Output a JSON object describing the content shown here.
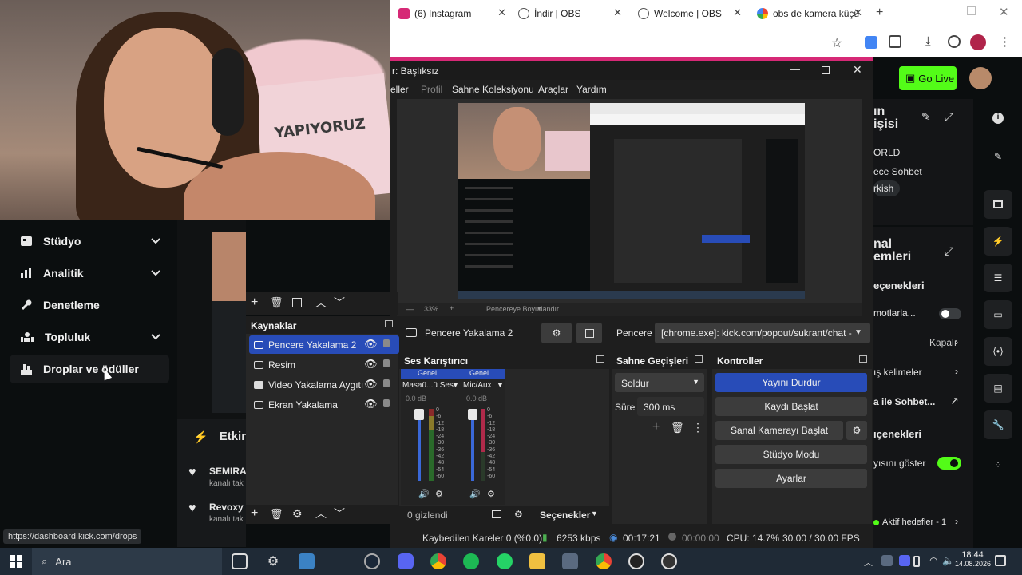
{
  "browser": {
    "tabs": [
      {
        "label": "(6) Instagram",
        "favicon_color": "#d62976"
      },
      {
        "label": "İndir | OBS",
        "favicon_color": "#555555"
      },
      {
        "label": "Welcome | OBS",
        "favicon_color": "#555555"
      },
      {
        "label": "obs de kamera küçü",
        "favicon_color": "#4285f4"
      }
    ],
    "new_tab": "+"
  },
  "kick_header": {
    "go_live_label": "Go Live",
    "go_live_color": "#53fc18"
  },
  "kick_left_nav": {
    "items": [
      {
        "label": "Stüdyo",
        "icon": "studio-icon",
        "has_chevron": true
      },
      {
        "label": "Analitik",
        "icon": "chart-icon",
        "has_chevron": true
      },
      {
        "label": "Denetleme",
        "icon": "wrench-icon",
        "has_chevron": false
      },
      {
        "label": "Topluluk",
        "icon": "community-icon",
        "has_chevron": true
      },
      {
        "label": "Droplar ve ödüller",
        "icon": "drops-icon",
        "has_chevron": false
      }
    ]
  },
  "kick_feed": {
    "title": "Etkin",
    "items": [
      {
        "name": "SEMIRA",
        "sub": "kanalı tak"
      },
      {
        "name": "Revoxy",
        "sub": "kanalı tak"
      }
    ]
  },
  "tooltip": "https://dashboard.kick.com/drops",
  "webcam": {
    "poster_text": "YAPIYORUZ"
  },
  "obs": {
    "window_title": "r: Başlıksız",
    "menu": [
      "eller",
      "Profil",
      "Sahne Koleksiyonu",
      "Araçlar",
      "Yardım"
    ],
    "preview_toolbar": {
      "zoom": "33%",
      "fit_label": "Pencereye Boyutlandır"
    },
    "sources": {
      "title": "Kaynaklar",
      "items": [
        {
          "label": "Pencere Yakalama 2",
          "icon": "window-icon",
          "selected": true
        },
        {
          "label": "Resim",
          "icon": "image-icon",
          "selected": false
        },
        {
          "label": "Video Yakalama Aygıtı",
          "icon": "camera-icon",
          "selected": false
        },
        {
          "label": "Ekran Yakalama",
          "icon": "monitor-icon",
          "selected": false
        }
      ]
    },
    "source_bar": {
      "name": "Pencere Yakalama 2",
      "window_label": "Pencere",
      "window_value": "[chrome.exe]: kick.com/popout/sukrant/chat -"
    },
    "mixer": {
      "title": "Ses Karıştırıcı",
      "channels": [
        {
          "tab": "Genel",
          "name": "Masaü...ü Ses",
          "db": "0.0 dB"
        },
        {
          "tab": "Genel",
          "name": "Mic/Aux",
          "db": "0.0 dB"
        }
      ],
      "scale": [
        "0",
        "-6",
        "-12",
        "-18",
        "-24",
        "-30",
        "-36",
        "-42",
        "-48",
        "-54",
        "-60"
      ]
    },
    "transitions": {
      "title": "Sahne Geçişleri",
      "selected": "Soldur",
      "duration_label": "Süre",
      "duration_value": "300 ms"
    },
    "controls": {
      "title": "Kontroller",
      "buttons": [
        "Yayını Durdur",
        "Kaydı Başlat",
        "Sanal Kamerayı Başlat",
        "Stüdyo Modu",
        "Ayarlar"
      ]
    },
    "dock_footer": {
      "hidden": "0 gizlendi",
      "options": "Seçenekler"
    },
    "status": {
      "dropped": "Kaybedilen Kareler 0 (%0.0)",
      "bitrate": "6253 kbps",
      "live_time": "00:17:21",
      "rec_time": "00:00:00",
      "cpu": "CPU: 14.7%",
      "fps": "30.00 / 30.00 FPS"
    }
  },
  "kick_right": {
    "panel1_title": "ın\nişisi",
    "items": [
      "ORLD",
      "ece Sohbet",
      "rkish"
    ],
    "panel2_title": "nal\nemleri",
    "options_title": "eçenekleri",
    "opt_items": [
      "motlarla...",
      "Kapalı",
      "ış kelimeler",
      "a ile Sohbet..."
    ],
    "options2_title": "ıçenekleri",
    "show_label": "yısını göster",
    "goals": "Aktif hedefler - 1"
  },
  "taskbar": {
    "search": "Ara",
    "time": "18:44",
    "date": "14.08.2026"
  }
}
